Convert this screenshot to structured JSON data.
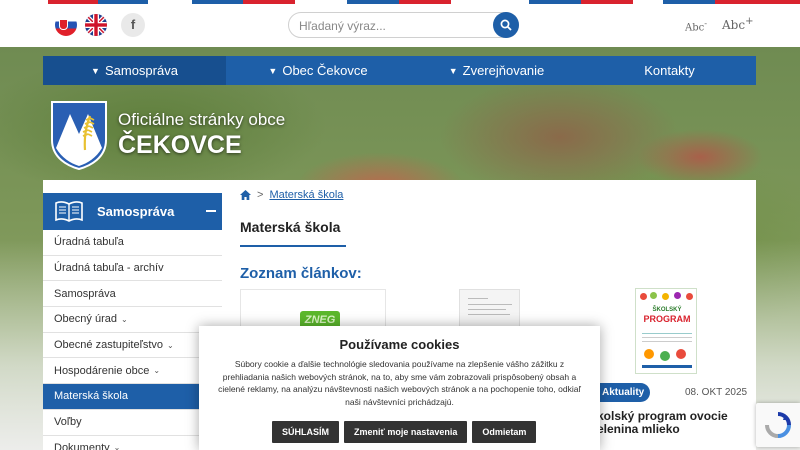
{
  "colors": {
    "primary": "#1e5fa8",
    "primary_dark": "#174f8f",
    "stripe_red": "#d9232e",
    "stripe_blue": "#1e5fa8",
    "cookie_button": "#333333"
  },
  "topbar": {
    "languages": [
      {
        "name": "slovak-flag-icon",
        "code": "sk"
      },
      {
        "name": "uk-flag-icon",
        "code": "en"
      }
    ],
    "facebook_icon": "facebook-icon",
    "facebook_glyph": "f",
    "search": {
      "placeholder": "Hľadaný výraz..."
    },
    "font_smaller": "Abc",
    "font_smaller_mark": "-",
    "font_larger": "Abc",
    "font_larger_mark": "+"
  },
  "nav": [
    {
      "label": "Samospráva",
      "dropdown": true,
      "active": true
    },
    {
      "label": "Obec Čekovce",
      "dropdown": true,
      "active": false
    },
    {
      "label": "Zverejňovanie",
      "dropdown": true,
      "active": false
    },
    {
      "label": "Kontakty",
      "dropdown": false,
      "active": false
    }
  ],
  "site": {
    "subtitle": "Oficiálne stránky obce",
    "name": "ČEKOVCE"
  },
  "sidebar": {
    "heading": "Samospráva",
    "items": [
      {
        "label": "Úradná tabuľa",
        "dropdown": false,
        "active": false
      },
      {
        "label": "Úradná tabuľa - archív",
        "dropdown": false,
        "active": false
      },
      {
        "label": "Samospráva",
        "dropdown": false,
        "active": false
      },
      {
        "label": "Obecný úrad",
        "dropdown": true,
        "active": false
      },
      {
        "label": "Obecné zastupiteľstvo",
        "dropdown": true,
        "active": false
      },
      {
        "label": "Hospodárenie obce",
        "dropdown": true,
        "active": false
      },
      {
        "label": "Materská škola",
        "dropdown": false,
        "active": true
      },
      {
        "label": "Voľby",
        "dropdown": false,
        "active": false
      },
      {
        "label": "Dokumenty",
        "dropdown": true,
        "active": false
      }
    ]
  },
  "breadcrumb": {
    "separator": ">",
    "current": "Materská škola"
  },
  "page": {
    "title": "Materská škola",
    "list_heading": "Zoznam článkov:"
  },
  "articles": [
    {
      "thumb_text": "ZNEG"
    },
    {
      "thumb_text": ""
    },
    {
      "poster_text_1": "ŠKOLSKÝ",
      "poster_text_2": "PROGRAM",
      "category": "Aktuality",
      "date": "08. OKT 2025",
      "title": "kolský program ovocie elenina mlieko"
    }
  ],
  "cookie": {
    "title": "Používame cookies",
    "body": "Súbory cookie a ďalšie technológie sledovania používame na zlepšenie vášho zážitku z prehliadania našich webových stránok, na to, aby sme vám zobrazovali prispôsobený obsah a cielené reklamy, na analýzu návštevnosti našich webových stránok a na pochopenie toho, odkiaľ naši návštevníci prichádzajú.",
    "buttons": {
      "accept": "SÚHLASÍM",
      "settings": "Zmeniť moje nastavenia",
      "reject": "Odmietam"
    }
  },
  "recaptcha_icon": "recaptcha-icon"
}
